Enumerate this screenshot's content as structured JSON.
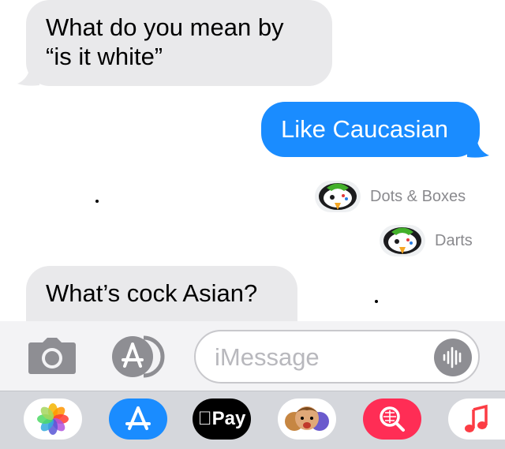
{
  "messages": [
    {
      "direction": "incoming",
      "text_line1": "What do you mean by",
      "text_line2": "“is it white”"
    },
    {
      "direction": "outgoing",
      "text": "Like Caucasian"
    },
    {
      "direction": "incoming",
      "text": "What’s cock Asian?"
    }
  ],
  "games": [
    {
      "label": "Dots & Boxes",
      "icon": "gamepigeon-icon"
    },
    {
      "label": "Darts",
      "icon": "gamepigeon-icon"
    }
  ],
  "composer": {
    "placeholder": "iMessage",
    "camera_icon": "camera-icon",
    "appstore_icon": "app-store-icon",
    "audio_icon": "audio-waveform-icon"
  },
  "app_drawer": {
    "apps": [
      {
        "name": "photos-app-icon"
      },
      {
        "name": "app-store-app-icon"
      },
      {
        "name": "apple-pay-app-icon",
        "label": "Pay"
      },
      {
        "name": "memoji-app-icon"
      },
      {
        "name": "search-images-app-icon"
      },
      {
        "name": "music-app-icon"
      }
    ]
  },
  "colors": {
    "outgoing_bubble": "#1a8cff",
    "incoming_bubble": "#e9e9eb",
    "icon_gray": "#8e8e93"
  }
}
